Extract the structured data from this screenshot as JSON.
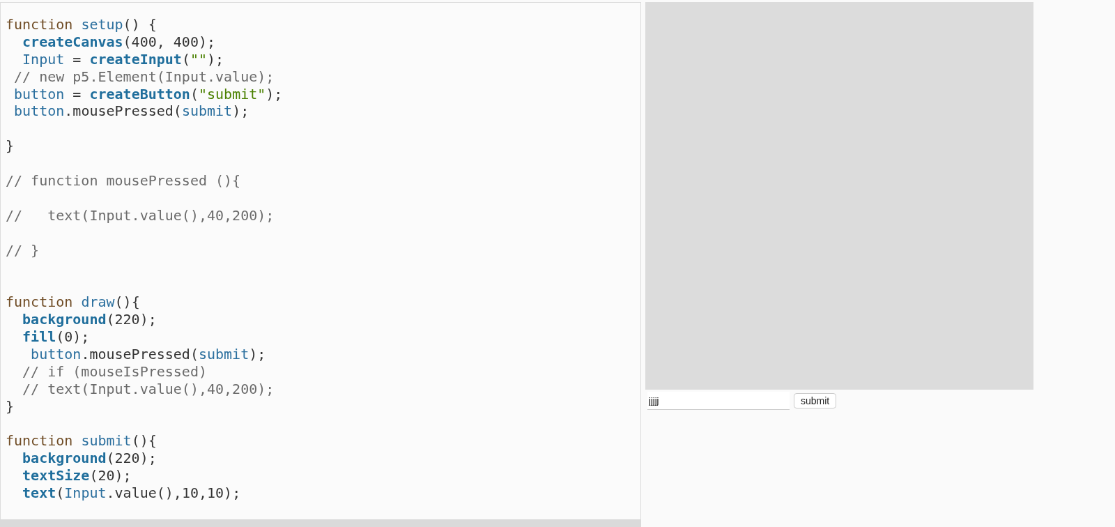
{
  "editor": {
    "lines": [
      {
        "kind": "code",
        "tokens": [
          {
            "kind": "keyword",
            "text": "function "
          },
          {
            "kind": "name",
            "text": "setup"
          },
          {
            "kind": "plain",
            "text": "() {"
          }
        ]
      },
      {
        "kind": "code",
        "tokens": [
          {
            "kind": "builtin",
            "text": "  createCanvas"
          },
          {
            "kind": "plain",
            "text": "(400, 400);"
          }
        ]
      },
      {
        "kind": "code",
        "tokens": [
          {
            "kind": "name",
            "text": "  Input"
          },
          {
            "kind": "plain",
            "text": " = "
          },
          {
            "kind": "builtin",
            "text": "createInput"
          },
          {
            "kind": "plain",
            "text": "("
          },
          {
            "kind": "string",
            "text": "\"\""
          },
          {
            "kind": "plain",
            "text": ");"
          }
        ]
      },
      {
        "kind": "code",
        "tokens": [
          {
            "kind": "comment",
            "text": " // new p5.Element(Input.value);"
          }
        ]
      },
      {
        "kind": "code",
        "tokens": [
          {
            "kind": "name",
            "text": " button"
          },
          {
            "kind": "plain",
            "text": " = "
          },
          {
            "kind": "builtin",
            "text": "createButton"
          },
          {
            "kind": "plain",
            "text": "("
          },
          {
            "kind": "string",
            "text": "\"submit\""
          },
          {
            "kind": "plain",
            "text": ");"
          }
        ]
      },
      {
        "kind": "code",
        "tokens": [
          {
            "kind": "name",
            "text": " button"
          },
          {
            "kind": "plain",
            "text": ".mousePressed("
          },
          {
            "kind": "name",
            "text": "submit"
          },
          {
            "kind": "plain",
            "text": ");"
          }
        ]
      },
      {
        "kind": "blank"
      },
      {
        "kind": "code",
        "tokens": [
          {
            "kind": "plain",
            "text": "}"
          }
        ]
      },
      {
        "kind": "blank"
      },
      {
        "kind": "code",
        "tokens": [
          {
            "kind": "comment",
            "text": "// function mousePressed (){"
          }
        ]
      },
      {
        "kind": "blank"
      },
      {
        "kind": "code",
        "tokens": [
          {
            "kind": "comment",
            "text": "//   text(Input.value(),40,200);"
          }
        ]
      },
      {
        "kind": "blank"
      },
      {
        "kind": "code",
        "tokens": [
          {
            "kind": "comment",
            "text": "// }"
          }
        ]
      },
      {
        "kind": "blank"
      },
      {
        "kind": "blank"
      },
      {
        "kind": "code",
        "tokens": [
          {
            "kind": "keyword",
            "text": "function "
          },
          {
            "kind": "name",
            "text": "draw"
          },
          {
            "kind": "plain",
            "text": "(){"
          }
        ]
      },
      {
        "kind": "code",
        "tokens": [
          {
            "kind": "builtin",
            "text": "  background"
          },
          {
            "kind": "plain",
            "text": "(220);"
          }
        ]
      },
      {
        "kind": "code",
        "tokens": [
          {
            "kind": "builtin",
            "text": "  fill"
          },
          {
            "kind": "plain",
            "text": "(0);"
          }
        ]
      },
      {
        "kind": "code",
        "tokens": [
          {
            "kind": "name",
            "text": "   button"
          },
          {
            "kind": "plain",
            "text": ".mousePressed("
          },
          {
            "kind": "name",
            "text": "submit"
          },
          {
            "kind": "plain",
            "text": ");"
          }
        ]
      },
      {
        "kind": "code",
        "tokens": [
          {
            "kind": "comment",
            "text": "  // if (mouseIsPressed)"
          }
        ]
      },
      {
        "kind": "code",
        "tokens": [
          {
            "kind": "comment",
            "text": "  // text(Input.value(),40,200);"
          }
        ]
      },
      {
        "kind": "code",
        "tokens": [
          {
            "kind": "plain",
            "text": "}"
          }
        ]
      },
      {
        "kind": "blank"
      },
      {
        "kind": "code",
        "tokens": [
          {
            "kind": "keyword",
            "text": "function "
          },
          {
            "kind": "name",
            "text": "submit"
          },
          {
            "kind": "plain",
            "text": "(){"
          }
        ]
      },
      {
        "kind": "code",
        "tokens": [
          {
            "kind": "builtin",
            "text": "  background"
          },
          {
            "kind": "plain",
            "text": "(220);"
          }
        ]
      },
      {
        "kind": "code",
        "tokens": [
          {
            "kind": "builtin",
            "text": "  textSize"
          },
          {
            "kind": "plain",
            "text": "(20);"
          }
        ]
      },
      {
        "kind": "code",
        "tokens": [
          {
            "kind": "builtin",
            "text": "  text"
          },
          {
            "kind": "plain",
            "text": "("
          },
          {
            "kind": "name",
            "text": "Input"
          },
          {
            "kind": "plain",
            "text": ".value(),10,10);"
          }
        ]
      }
    ]
  },
  "preview": {
    "input": {
      "value": "jjjjj"
    },
    "button": "submit"
  }
}
